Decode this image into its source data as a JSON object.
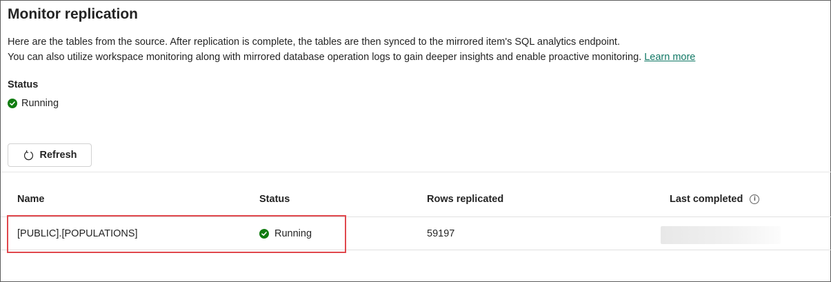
{
  "page": {
    "title": "Monitor replication",
    "description_line1": "Here are the tables from the source. After replication is complete, the tables are then synced to the mirrored item's SQL analytics endpoint.",
    "description_line2": "You can also utilize workspace monitoring along with mirrored database operation logs to gain deeper insights and enable proactive monitoring.",
    "learn_more_label": "Learn more"
  },
  "status": {
    "label": "Status",
    "value": "Running",
    "icon": "check-circle-icon",
    "color": "#107c10"
  },
  "toolbar": {
    "refresh_label": "Refresh",
    "refresh_icon": "refresh-icon"
  },
  "table": {
    "columns": [
      "Name",
      "Status",
      "Rows replicated",
      "Last completed"
    ],
    "rows": [
      {
        "name": "[PUBLIC].[POPULATIONS]",
        "status": "Running",
        "rows_replicated": "59197",
        "last_completed": ""
      }
    ]
  },
  "colors": {
    "highlight": "#e0474c",
    "link": "#117865",
    "success": "#107c10"
  }
}
